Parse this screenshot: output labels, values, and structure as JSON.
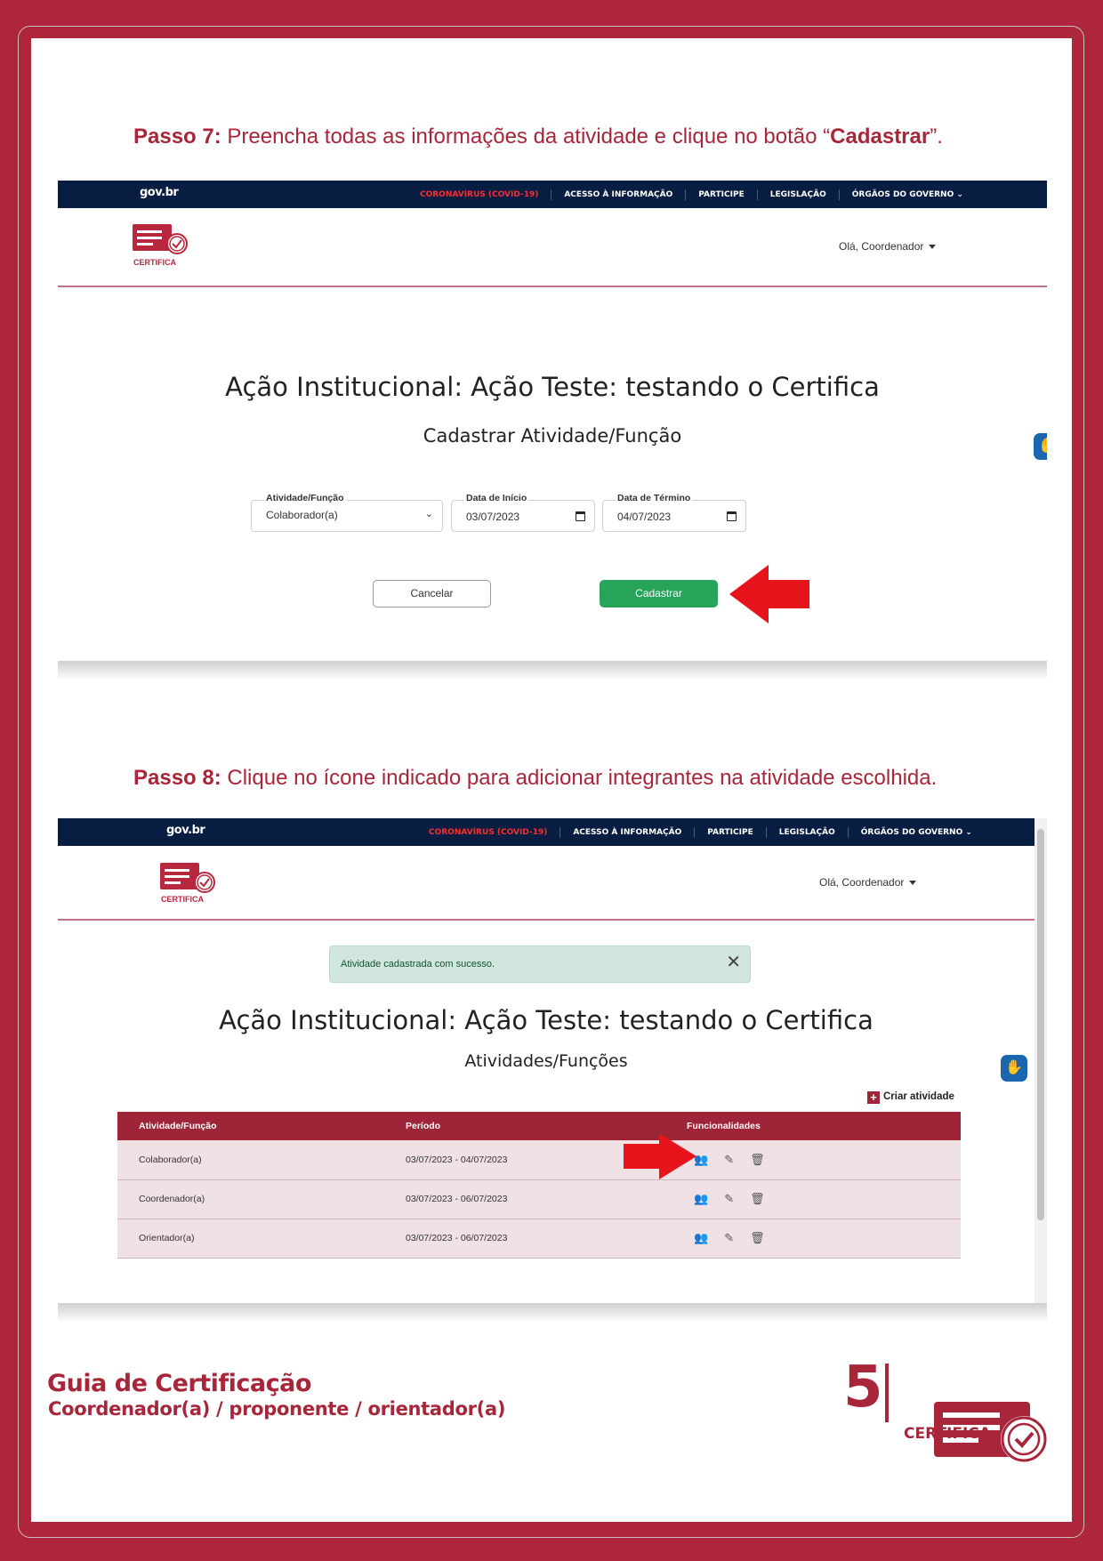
{
  "colors": {
    "brand": "#a8263a",
    "gov_bar": "#071d41",
    "success_button": "#28a35a",
    "alert_bg": "#d1e7dd",
    "table_header": "#9e2437",
    "arrow": "#e8141b"
  },
  "step7": {
    "prefix": "Passo 7:",
    "text_before": " Preencha todas as informações da atividade e clique no botão “",
    "emphasis": "Cadastrar",
    "text_after": "”."
  },
  "step8": {
    "prefix": "Passo 8:",
    "text": " Clique no ícone indicado para adicionar integrantes na atividade escolhida."
  },
  "gov_bar": {
    "logo": "gov.br",
    "links": [
      "CORONAVÍRUS (COVID-19)",
      "ACESSO À INFORMAÇÃO",
      "PARTICIPE",
      "LEGISLAÇÃO",
      "ÓRGÃOS DO GOVERNO"
    ]
  },
  "app": {
    "brand_text": "CERTIFICA",
    "user_menu": "Olá, Coordenador",
    "page_title": "Ação Institucional: Ação Teste: testando o Certifica"
  },
  "form": {
    "subtitle": "Cadastrar Atividade/Função",
    "activity_label": "Atividade/Função",
    "activity_value": "Colaborador(a)",
    "start_label": "Data de Início",
    "start_value": "03/07/2023",
    "end_label": "Data de Término",
    "end_value": "04/07/2023",
    "cancel_label": "Cancelar",
    "submit_label": "Cadastrar"
  },
  "list": {
    "alert": "Atividade cadastrada com sucesso.",
    "subtitle": "Atividades/Funções",
    "add_label": "Criar atividade",
    "columns": [
      "Atividade/Função",
      "Período",
      "Funcionalidades"
    ],
    "rows": [
      {
        "activity": "Colaborador(a)",
        "period": "03/07/2023 - 04/07/2023"
      },
      {
        "activity": "Coordenador(a)",
        "period": "03/07/2023 - 06/07/2023"
      },
      {
        "activity": "Orientador(a)",
        "period": "03/07/2023 - 06/07/2023"
      }
    ],
    "icons": [
      "add-members-icon",
      "edit-icon",
      "delete-icon"
    ]
  },
  "footer": {
    "title": "Guia de Certificação",
    "subtitle": "Coordenador(a) / proponente / orientador(a)",
    "page_number": "5",
    "brand_text": "CERTIFICA"
  }
}
